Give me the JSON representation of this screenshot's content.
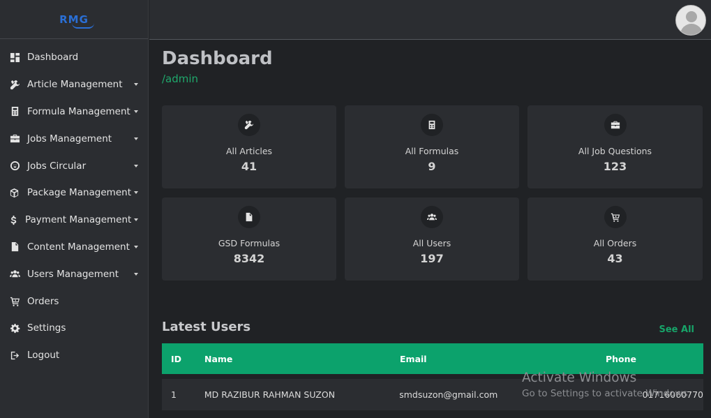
{
  "brand": {
    "logo_text": "RMG"
  },
  "sidebar": {
    "items": [
      {
        "label": "Dashboard",
        "icon": "dashboard-icon",
        "has_caret": false
      },
      {
        "label": "Article Management",
        "icon": "tools-icon",
        "has_caret": true
      },
      {
        "label": "Formula Management",
        "icon": "calculator-icon",
        "has_caret": true
      },
      {
        "label": "Jobs Management",
        "icon": "briefcase-icon",
        "has_caret": true
      },
      {
        "label": "Jobs Circular",
        "icon": "circle-icon",
        "has_caret": true
      },
      {
        "label": "Package Management",
        "icon": "package-icon",
        "has_caret": true
      },
      {
        "label": "Payment Management",
        "icon": "dollar-icon",
        "has_caret": true
      },
      {
        "label": "Content Management",
        "icon": "document-icon",
        "has_caret": true
      },
      {
        "label": "Users Management",
        "icon": "users-icon",
        "has_caret": true
      },
      {
        "label": "Orders",
        "icon": "cart-icon",
        "has_caret": false
      },
      {
        "label": "Settings",
        "icon": "gear-icon",
        "has_caret": false
      },
      {
        "label": "Logout",
        "icon": "logout-icon",
        "has_caret": false
      }
    ]
  },
  "header": {
    "avatar": "user-avatar-icon"
  },
  "page": {
    "title": "Dashboard",
    "breadcrumb": "/admin"
  },
  "cards": [
    {
      "label": "All Articles",
      "value": "41",
      "icon": "tools-icon"
    },
    {
      "label": "All Formulas",
      "value": "9",
      "icon": "calculator-icon"
    },
    {
      "label": "All Job Questions",
      "value": "123",
      "icon": "briefcase-icon"
    },
    {
      "label": "GSD Formulas",
      "value": "8342",
      "icon": "document-icon"
    },
    {
      "label": "All Users",
      "value": "197",
      "icon": "users-icon"
    },
    {
      "label": "All Orders",
      "value": "43",
      "icon": "cart-icon"
    }
  ],
  "latest_users": {
    "title": "Latest Users",
    "see_all": "See All",
    "columns": [
      "ID",
      "Name",
      "Email",
      "Phone"
    ],
    "rows": [
      {
        "id": "1",
        "name": "MD RAZIBUR RAHMAN SUZON",
        "email": "smdsuzon@gmail.com",
        "phone": "01716060770"
      }
    ]
  },
  "watermark": {
    "line1": "Activate Windows",
    "line2": "Go to Settings to activate Windows."
  },
  "colors": {
    "accent": "#0ca26c",
    "background": "#202225",
    "panel": "#2b2d31",
    "logo": "#2a6fd6"
  }
}
